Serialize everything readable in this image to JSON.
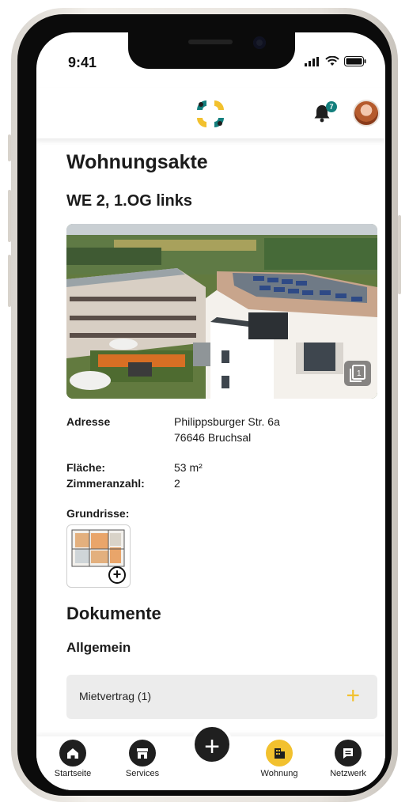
{
  "status_bar": {
    "time": "9:41"
  },
  "header": {
    "notification_count": "7",
    "brand_colors": [
      "#137f7d",
      "#f2c12e",
      "#1f1f1f"
    ]
  },
  "page": {
    "title": "Wohnungsakte",
    "unit": "WE 2, 1.OG links",
    "photo_count": "1",
    "address_label": "Adresse",
    "address_line1": "Philippsburger Str. 6a",
    "address_line2": "76646 Bruchsal",
    "area_label": "Fläche:",
    "area_value": "53 m²",
    "rooms_label": "Zimmeranzahl:",
    "rooms_value": "2",
    "floorplans_label": "Grundrisse:"
  },
  "documents": {
    "title": "Dokumente",
    "section": "Allgemein",
    "items": [
      {
        "label": "Mietvertrag (1)"
      }
    ]
  },
  "tabbar": {
    "items": [
      {
        "label": "Startseite",
        "icon": "home-icon"
      },
      {
        "label": "Services",
        "icon": "store-icon"
      },
      {
        "label": "Wohnung",
        "icon": "building-icon",
        "active": true
      },
      {
        "label": "Netzwerk",
        "icon": "chat-icon"
      }
    ],
    "accent": "#f2c12e"
  }
}
